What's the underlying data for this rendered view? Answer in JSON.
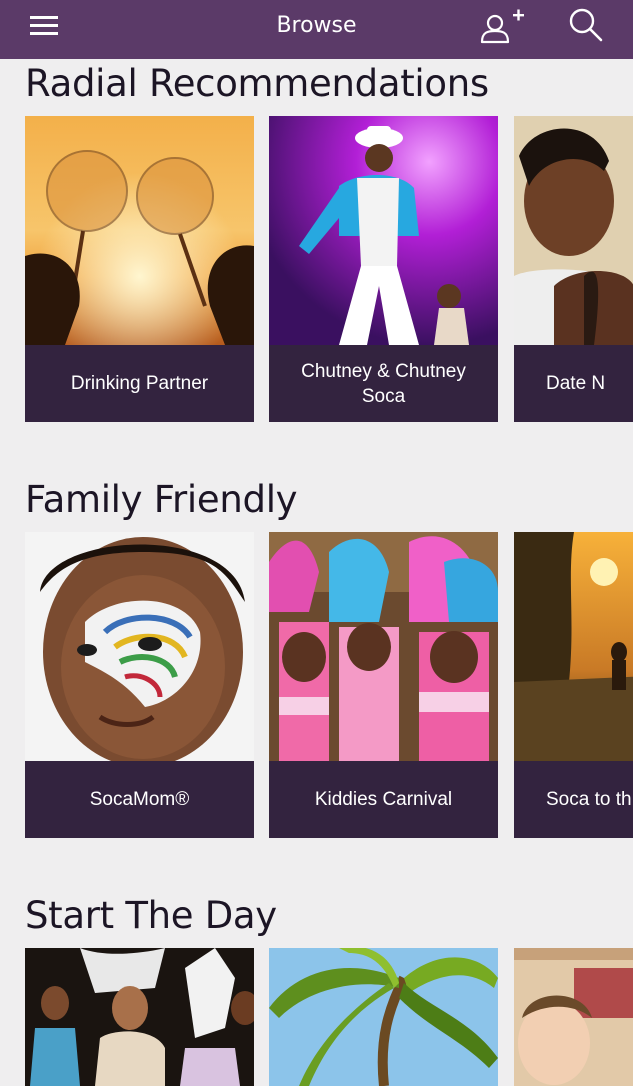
{
  "header": {
    "title": "Browse",
    "background": "#5b3a68"
  },
  "sections": [
    {
      "title": "Radial Recommendations",
      "cards": [
        {
          "label": "Drinking Partner"
        },
        {
          "label": "Chutney & Chutney Soca"
        },
        {
          "label": "Date N"
        }
      ]
    },
    {
      "title": "Family Friendly",
      "cards": [
        {
          "label": "SocaMom®"
        },
        {
          "label": "Kiddies Carnival"
        },
        {
          "label": "Soca to th"
        }
      ]
    },
    {
      "title": "Start The Day",
      "cards": []
    }
  ],
  "colors": {
    "card_label_bg": "#33233f",
    "page_bg": "#efeeef"
  },
  "icons": [
    "menu-icon",
    "add-friend-icon",
    "search-icon"
  ]
}
